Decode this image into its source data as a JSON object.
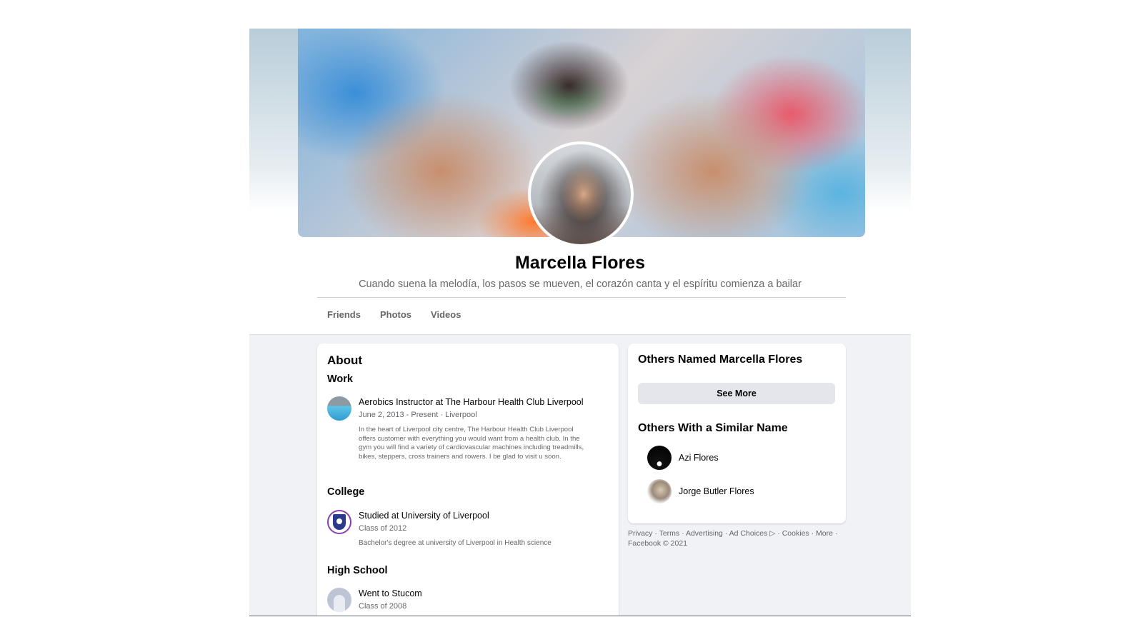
{
  "profile": {
    "name": "Marcella Flores",
    "bio": "Cuando suena la melodía, los pasos se mueven, el corazón canta y el espíritu comienza a bailar"
  },
  "nav": {
    "friends": "Friends",
    "photos": "Photos",
    "videos": "Videos"
  },
  "about": {
    "title": "About",
    "work": {
      "heading": "Work",
      "title": "Aerobics Instructor at The Harbour Health Club Liverpool",
      "meta": "June 2, 2013 - Present · Liverpool",
      "description": "In the heart of Liverpool city centre, The Harbour Health Club Liverpool offers customer with everything you would want from a health club. In the gym you will find a variety of cardiovascular machines including treadmills, bikes, steppers, cross trainers and rowers. I be glad to visit u soon."
    },
    "college": {
      "heading": "College",
      "title": "Studied at University of Liverpool",
      "meta": "Class of 2012",
      "description": "Bachelor's degree at university of Liverpool in Health science"
    },
    "high_school": {
      "heading": "High School",
      "title": "Went to Stucom",
      "meta": "Class of 2008"
    }
  },
  "sidebar": {
    "others_named_title": "Others Named Marcella Flores",
    "see_more": "See More",
    "similar_title": "Others With a Similar Name",
    "people": [
      {
        "name": "Azi Flores"
      },
      {
        "name": "Jorge Butler Flores"
      }
    ]
  },
  "footer": {
    "privacy": "Privacy",
    "terms": "Terms",
    "advertising": "Advertising",
    "ad_choices": "Ad Choices",
    "ad_choices_icon": "▷",
    "cookies": "Cookies",
    "more": "More",
    "copyright": "Facebook © 2021"
  }
}
